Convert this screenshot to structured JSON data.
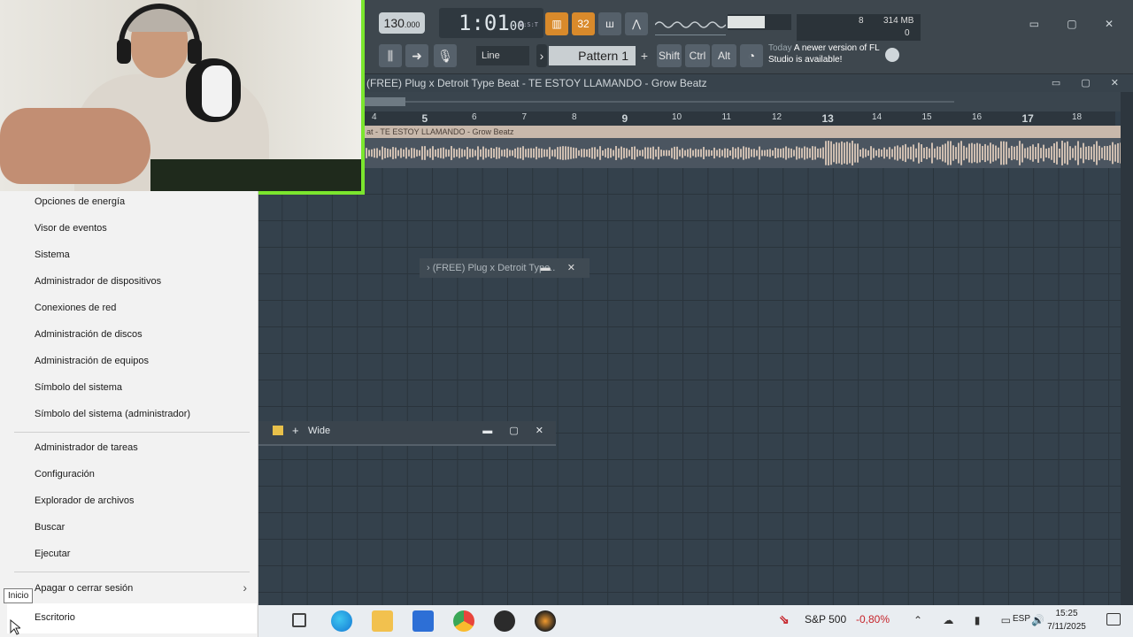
{
  "fl": {
    "tempo": "130",
    "tempo_frac": ".000",
    "time": "1:01",
    "time_sub": "00",
    "time_label": "B:S:T",
    "step_btn_a": "32",
    "memory": "314 MB",
    "cpu_val": "8",
    "cpu_val2": "0",
    "line_mode": "Line",
    "pattern": "Pattern 1",
    "mod_shift": "Shift",
    "mod_ctrl": "Ctrl",
    "mod_alt": "Alt",
    "hint_today": "Today",
    "hint_text": "A newer version of FL Studio is available!",
    "playlist_title": "(FREE) Plug x Detroit Type Beat - TE ESTOY LLAMANDO - Grow Beatz",
    "clip_title": "at - TE ESTOY LLAMANDO - Grow Beatz",
    "ruler": [
      "4",
      "5",
      "6",
      "7",
      "8",
      "9",
      "10",
      "11",
      "12",
      "13",
      "14",
      "15",
      "16",
      "17",
      "18"
    ],
    "float_window_title": "(FREE) Plug x Detroit Type..",
    "wide_window_title": "Wide"
  },
  "winx_menu": {
    "items_top": [
      "Opciones de energía",
      "Visor de eventos",
      "Sistema",
      "Administrador de dispositivos",
      "Conexiones de red",
      "Administración de discos",
      "Administración de equipos",
      "Símbolo del sistema",
      "Símbolo del sistema (administrador)"
    ],
    "items_mid": [
      "Administrador de tareas",
      "Configuración",
      "Explorador de archivos",
      "Buscar",
      "Ejecutar"
    ],
    "shutdown": "Apagar o cerrar sesión",
    "desktop": "Escritorio"
  },
  "tooltip": "Inicio",
  "taskbar": {
    "stock_name": "S&P 500",
    "stock_change": "-0,80%",
    "language": "ESP",
    "time": "15:25",
    "date": "7/11/2025"
  },
  "colors": {
    "webcam_border": "#7be62e",
    "accent_orange": "#d98a2b",
    "stock_red": "#c6232a"
  }
}
